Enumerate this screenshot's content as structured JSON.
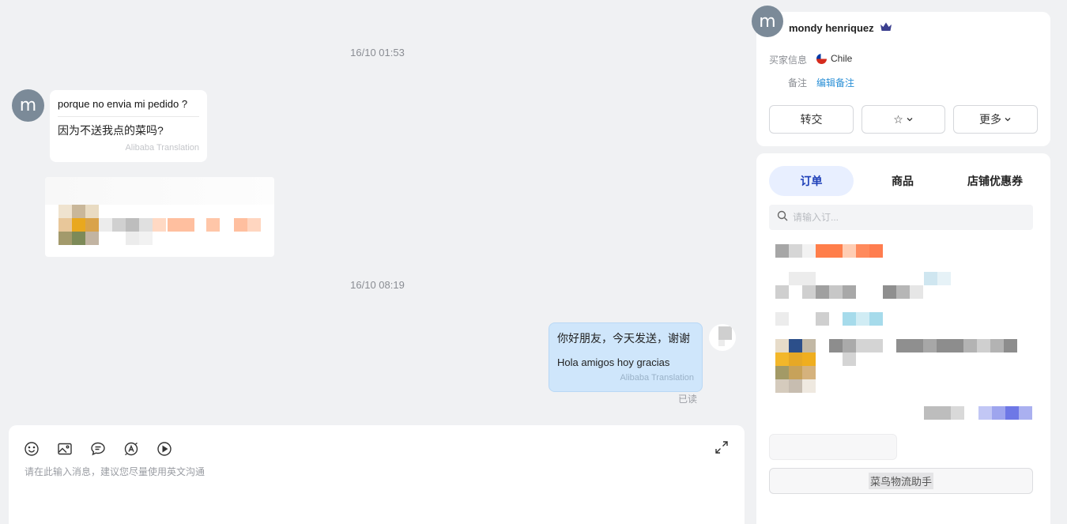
{
  "chat": {
    "timestamps": [
      "16/10 01:53",
      "16/10 08:19"
    ],
    "avatar_letter": "m",
    "incoming": {
      "original": "porque no  envia mi pedido ?",
      "translation": "因为不送我点的菜吗?",
      "translated_by": "Alibaba Translation"
    },
    "outgoing": {
      "original": "你好朋友，今天发送，谢谢",
      "translation": "Hola amigos hoy gracias",
      "translated_by": "Alibaba Translation",
      "status": "已读"
    }
  },
  "composer": {
    "placeholder": "请在此输入消息，建议您尽量使用英文沟通",
    "tools": [
      "emoji-icon",
      "image-icon",
      "quick-reply-icon",
      "translate-icon",
      "video-icon"
    ]
  },
  "buyer": {
    "avatar_letter": "m",
    "name": "mondy henriquez",
    "country_label": "买家信息",
    "country": "Chile",
    "note_label": "备注",
    "edit_note": "编辑备注",
    "buttons": {
      "transfer": "转交",
      "star": "☆",
      "more": "更多"
    }
  },
  "orders_panel": {
    "tabs": [
      "订单",
      "商品",
      "店铺优惠券"
    ],
    "active_tab": "订单",
    "search_placeholder": "请输入订...",
    "logistics_button": "菜鸟物流助手"
  },
  "colors": {
    "accent": "#1d3fb8",
    "link": "#2a8fd6",
    "outgoing_bubble": "#cfe6fb",
    "avatar": "#7b8a98"
  }
}
